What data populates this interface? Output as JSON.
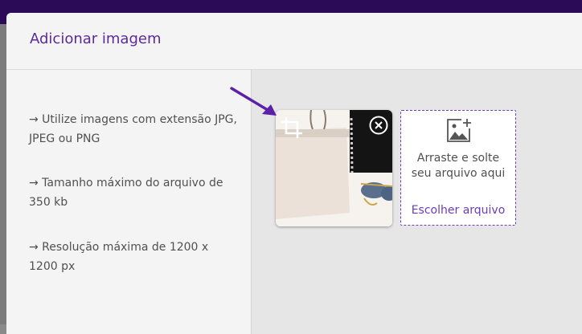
{
  "dialog": {
    "title": "Adicionar imagem"
  },
  "info": {
    "lines": [
      "→ Utilize imagens com extensão JPG, JPEG ou PNG",
      "→ Tamanho máximo do arquivo de 350 kb",
      "→ Resolução máxima de 1200 x 1200 px"
    ]
  },
  "dropzone": {
    "text": "Arraste e solte seu arquivo aqui",
    "link": "Escolher arquivo",
    "icon": "add-image-icon"
  },
  "thumbnail": {
    "crop_icon": "crop-icon",
    "remove_icon": "close-circle-icon"
  },
  "colors": {
    "accent": "#6a3cb8",
    "topbar": "#2b0a57",
    "arrow": "#5b1fa8"
  }
}
